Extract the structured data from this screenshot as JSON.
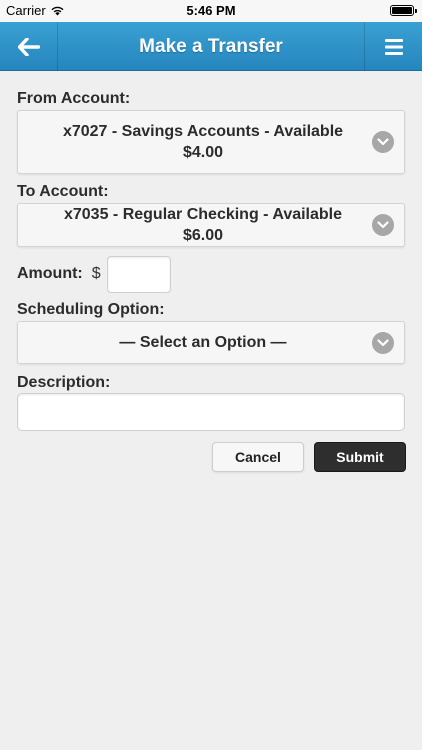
{
  "status_bar": {
    "carrier": "Carrier",
    "time": "5:46 PM"
  },
  "nav": {
    "title": "Make a Transfer",
    "back_icon": "arrow-left-icon",
    "menu_icon": "hamburger-menu-icon",
    "color": "#2a8fc6"
  },
  "form": {
    "from_label": "From Account:",
    "from_value": "x7027 - Savings Accounts - Available $4.00",
    "to_label": "To Account:",
    "to_value": "x7035 - Regular Checking - Available $6.00",
    "amount_label": "Amount:",
    "currency_symbol": "$",
    "amount_value": "",
    "scheduling_label": "Scheduling Option:",
    "scheduling_value": "— Select an Option —",
    "description_label": "Description:",
    "description_value": ""
  },
  "actions": {
    "cancel_label": "Cancel",
    "submit_label": "Submit",
    "submit_color": "#2e2e2e"
  }
}
